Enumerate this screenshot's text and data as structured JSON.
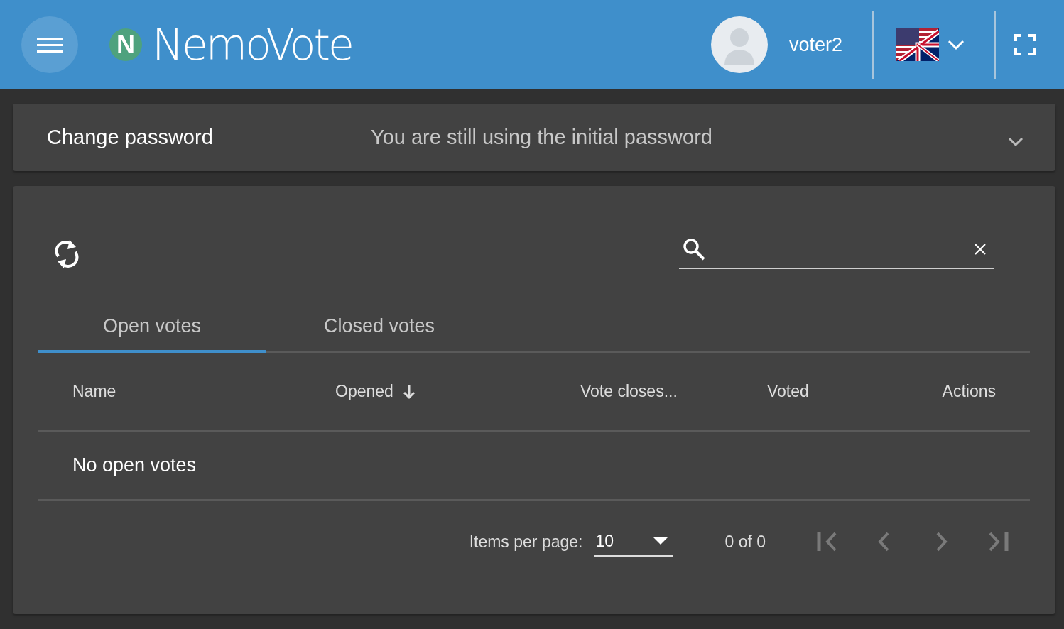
{
  "header": {
    "logo_letter": "N",
    "logo_text": "NemoVote",
    "username": "voter2"
  },
  "password_panel": {
    "title": "Change password",
    "description": "You are still using the initial password",
    "expanded": false
  },
  "votes_card": {
    "tabs": [
      {
        "label": "Open votes",
        "selected": true
      },
      {
        "label": "Closed votes",
        "selected": false
      }
    ],
    "table": {
      "columns": [
        {
          "label": "Name",
          "sorted": false
        },
        {
          "label": "Opened",
          "sorted": true
        },
        {
          "label": "Vote closes...",
          "sorted": false
        },
        {
          "label": "Voted",
          "sorted": false
        },
        {
          "label": "Actions",
          "sorted": false
        }
      ],
      "empty_message": "No open votes"
    },
    "paginator": {
      "items_per_page_label": "Items per page:",
      "page_size": "10",
      "range": "0 of 0",
      "buttons": [
        {
          "kind": "first",
          "disabled": true
        },
        {
          "kind": "previous",
          "disabled": true
        },
        {
          "kind": "next",
          "disabled": true
        },
        {
          "kind": "last",
          "disabled": true
        }
      ]
    }
  }
}
